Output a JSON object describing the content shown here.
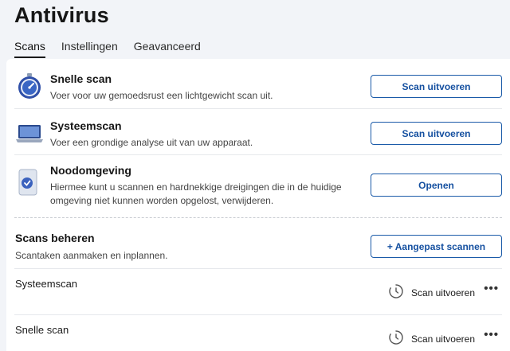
{
  "app": {
    "title": "Antivirus"
  },
  "tabs": [
    {
      "label": "Scans",
      "active": true
    },
    {
      "label": "Instellingen",
      "active": false
    },
    {
      "label": "Geavanceerd",
      "active": false
    }
  ],
  "scans": [
    {
      "title": "Snelle scan",
      "description": "Voer voor uw gemoedsrust een lichtgewicht scan uit.",
      "button": "Scan uitvoeren",
      "icon": "stopwatch-icon"
    },
    {
      "title": "Systeemscan",
      "description": "Voer een grondige analyse uit van uw apparaat.",
      "button": "Scan uitvoeren",
      "icon": "laptop-icon"
    },
    {
      "title": "Noodomgeving",
      "description_line1": "Hiermee kunt u scannen en hardnekkige dreigingen die in de huidige",
      "description_line2": "omgeving niet kunnen worden opgelost, verwijderen.",
      "button": "Openen",
      "icon": "rescue-disk-icon"
    }
  ],
  "manage": {
    "title": "Scans beheren",
    "description": "Scantaken aanmaken en inplannen.",
    "button": "+ Aangepast scannen"
  },
  "scheduled": [
    {
      "name": "Systeemscan",
      "action": "Scan uitvoeren",
      "more": "•••"
    },
    {
      "name": "Snelle scan",
      "action": "Scan uitvoeren",
      "more": "•••"
    }
  ],
  "colors": {
    "accent": "#1550a0",
    "background": "#f2f4f8",
    "card": "#ffffff"
  }
}
